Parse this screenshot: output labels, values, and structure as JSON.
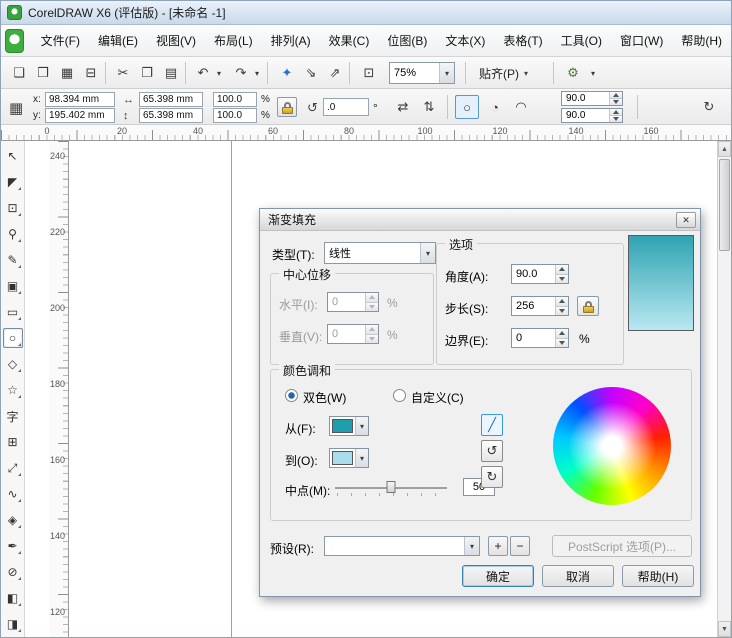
{
  "titlebar": {
    "title": "CorelDRAW X6 (评估版) - [未命名 -1]"
  },
  "menubar": {
    "items": [
      "文件(F)",
      "编辑(E)",
      "视图(V)",
      "布局(L)",
      "排列(A)",
      "效果(C)",
      "位图(B)",
      "文本(X)",
      "表格(T)",
      "工具(O)",
      "窗口(W)",
      "帮助(H)"
    ]
  },
  "toolbar": {
    "zoom_value": "75%",
    "snap_label": "贴齐(P)"
  },
  "icons": {
    "close": "✕",
    "new": "❏",
    "open": "❒",
    "save": "▦",
    "print": "⊟",
    "cut": "✂",
    "copy": "❐",
    "paste": "▤",
    "undo": "↶",
    "redo": "↷",
    "launcher": "✦",
    "import": "⇘",
    "export": "⇗",
    "fullscreen": "⊡",
    "gear": "⚙",
    "chevron": "▾",
    "grid": "▦",
    "width": "↔",
    "height": "↕",
    "rotate": "↺",
    "mirror_h": "⇄",
    "mirror_v": "⇅",
    "ellipse": "○",
    "pie": "◔",
    "arc": "◠",
    "circular": "↻",
    "path_direct": "╱",
    "path_ccw": "↺",
    "path_cw": "↻",
    "plus": "+",
    "minus": "−",
    "scroll_up": "▲",
    "scroll_down": "▼"
  },
  "propbar": {
    "x_label": "x:",
    "x_value": "98.394 mm",
    "y_label": "y:",
    "y_value": "195.402 mm",
    "width_value": "65.398 mm",
    "height_value": "65.398 mm",
    "scale_x": "100.0",
    "scale_y": "100.0",
    "percent": "%",
    "rotation_value": ".0",
    "degree": "°",
    "arc_start": "90.0",
    "arc_end": "90.0"
  },
  "rulers": {
    "h": [
      "0",
      "20",
      "40",
      "60",
      "80",
      "100",
      "120",
      "140",
      "160"
    ],
    "v": [
      "240",
      "220",
      "200",
      "180",
      "160",
      "140",
      "120"
    ]
  },
  "toolbox": [
    {
      "name": "pick",
      "glyph": "↖"
    },
    {
      "name": "shape",
      "glyph": "◤"
    },
    {
      "name": "crop",
      "glyph": "⊡"
    },
    {
      "name": "zoom",
      "glyph": "⚲"
    },
    {
      "name": "freehand",
      "glyph": "✎"
    },
    {
      "name": "smart-fill",
      "glyph": "▣"
    },
    {
      "name": "rectangle",
      "glyph": "▭"
    },
    {
      "name": "ellipse",
      "glyph": "○"
    },
    {
      "name": "polygon",
      "glyph": "◇"
    },
    {
      "name": "basic-shapes",
      "glyph": "☆"
    },
    {
      "name": "text",
      "glyph": "字"
    },
    {
      "name": "table",
      "glyph": "⊞"
    },
    {
      "name": "dimension",
      "glyph": "⤢"
    },
    {
      "name": "connector",
      "glyph": "∿"
    },
    {
      "name": "blend",
      "glyph": "◈"
    },
    {
      "name": "eyedropper",
      "glyph": "✒"
    },
    {
      "name": "outline-pen",
      "glyph": "⊘"
    },
    {
      "name": "fill",
      "glyph": "◧"
    },
    {
      "name": "interactive-fill",
      "glyph": "◨"
    }
  ],
  "dialog": {
    "title": "渐变填充",
    "type_label": "类型(T):",
    "type_value": "线性",
    "center_group_label": "中心位移",
    "horizontal_label": "水平(I):",
    "horizontal_value": "0",
    "vertical_label": "垂直(V):",
    "vertical_value": "0",
    "options_label": "选项",
    "angle_label": "角度(A):",
    "angle_value": "90.0",
    "steps_label": "步长(S):",
    "steps_value": "256",
    "edge_label": "边界(E):",
    "edge_value": "0",
    "percent": "%",
    "blend_group_label": "颜色调和",
    "two_color_label": "双色(W)",
    "custom_label": "自定义(C)",
    "from_label": "从(F):",
    "to_label": "到(O):",
    "midpoint_label": "中点(M):",
    "midpoint_value": "50",
    "preset_label": "预设(R):",
    "preset_value": "",
    "postscript_label": "PostScript 选项(P)...",
    "ok_label": "确定",
    "cancel_label": "取消",
    "help_label": "帮助(H)"
  },
  "colors": {
    "from_swatch": "#1f9fae",
    "to_swatch": "#aadcee",
    "preview_top": "#2fa3b2",
    "preview_bottom": "#b9e8f2"
  }
}
